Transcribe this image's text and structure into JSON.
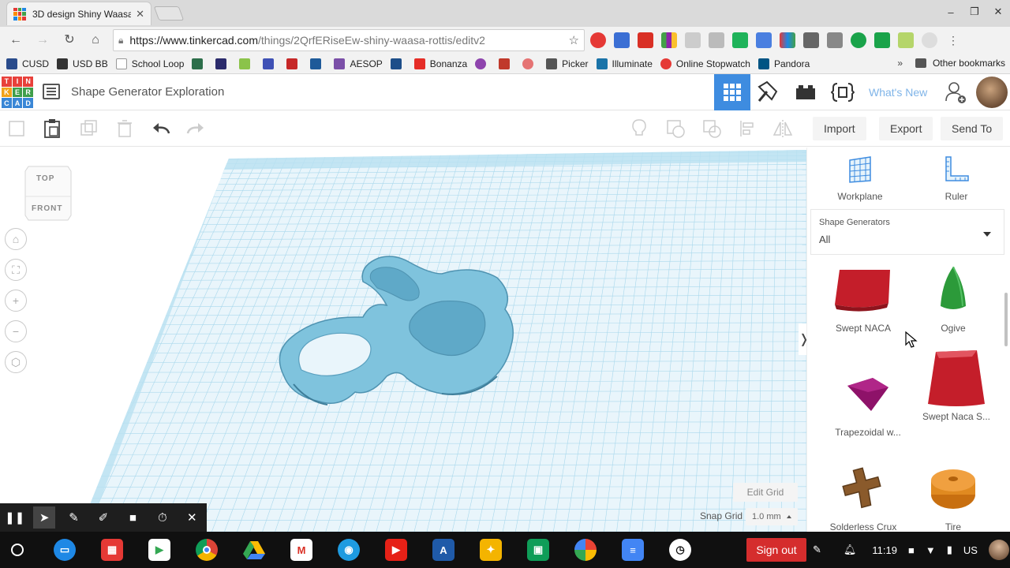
{
  "browser": {
    "tab_title": "3D design Shiny Waasa",
    "tab_close": "✕",
    "url_host": "https://www.tinkercad.com",
    "url_path": "/things/2QrfERiseEw-shiny-waasa-rottis/editv2",
    "window_minimize": "–",
    "window_maximize": "❐",
    "window_close": "✕"
  },
  "bookmarks": {
    "items": [
      "CUSD",
      "USD BB",
      "School Loop",
      "",
      "",
      "",
      "",
      "",
      "AESOP",
      "",
      "Bonanza",
      "",
      "",
      "",
      "Picker",
      "Illuminate",
      "Online Stopwatch",
      "Pandora"
    ],
    "more": "»",
    "other": "Other bookmarks"
  },
  "app": {
    "logo_letters": [
      "T",
      "I",
      "N",
      "K",
      "E",
      "R",
      "C",
      "A",
      "D"
    ],
    "design_title": "Shape Generator Exploration",
    "whats_new": "What's New"
  },
  "toolbar": {
    "import_label": "Import",
    "export_label": "Export",
    "send_to_label": "Send To"
  },
  "workspace": {
    "view_cube_top": "TOP",
    "view_cube_front": "FRONT",
    "edit_grid_label": "Edit Grid",
    "snap_grid_label": "Snap Grid",
    "snap_grid_value": "1.0 mm"
  },
  "panel": {
    "workplane_label": "Workplane",
    "ruler_label": "Ruler",
    "generators_label": "Shape Generators",
    "generators_value": "All",
    "shapes": [
      {
        "name": "Swept NACA",
        "color": "#c41e2a"
      },
      {
        "name": "Ogive",
        "color": "#2c9a3a"
      },
      {
        "name": "Trapezoidal w...",
        "color": "#8e1269"
      },
      {
        "name": "Swept Naca S...",
        "color": "#c41e2a"
      },
      {
        "name": "Solderless Crux",
        "color": "#8a5a2b"
      },
      {
        "name": "Tire",
        "color": "#e08a20"
      }
    ]
  },
  "shelf": {
    "signout_label": "Sign out",
    "time": "11:19",
    "locale": "US"
  },
  "colors": {
    "accent": "#3e8ce0",
    "model": "#6fb3d2",
    "grid_line": "#8ccbe4"
  }
}
